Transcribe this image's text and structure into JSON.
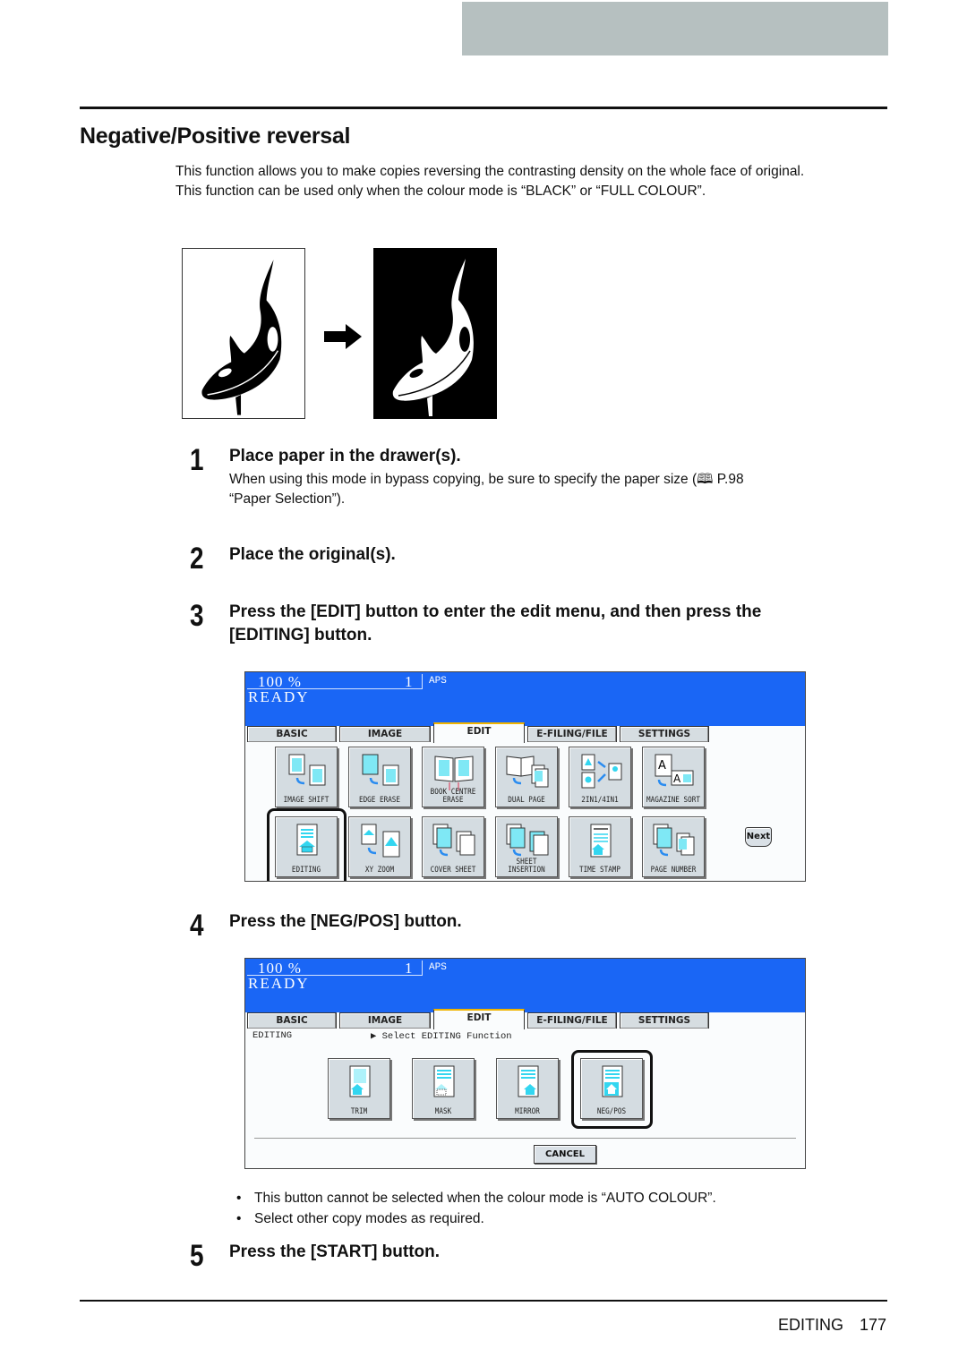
{
  "page": {
    "title": "Negative/Positive reversal",
    "intro": [
      "This function allows you to make copies reversing the contrasting density on the whole face of original.",
      "This function can be used only when the colour mode is “BLACK” or “FULL COLOUR”."
    ],
    "illustration": {
      "left_caption": "original-whale-image",
      "right_caption": "reversed-whale-image"
    },
    "steps": [
      {
        "num": "1",
        "title": "Place paper in the drawer(s).",
        "body": [
          "When using this mode in bypass copying, be sure to specify the paper size (🕮 P.98",
          "“Paper Selection”)."
        ]
      },
      {
        "num": "2",
        "title": "Place the original(s).",
        "body": []
      },
      {
        "num": "3",
        "title": "Press the [EDIT] button to enter the edit menu, and then press the",
        "title2": "[EDITING] button.",
        "body": []
      },
      {
        "num": "4",
        "title": "Press the [NEG/POS] button.",
        "body": []
      },
      {
        "num": "5",
        "title": "Press the [START] button.",
        "body": []
      }
    ],
    "bullets": [
      "This button cannot be selected when the colour mode is “AUTO COLOUR”.",
      "Select other copy modes as required."
    ],
    "footer": {
      "section": "EDITING",
      "page_number": "177"
    }
  },
  "panel": {
    "zoom": "100  %",
    "copies": "1",
    "paper": "APS",
    "status": "READY",
    "tabs": [
      "BASIC",
      "IMAGE",
      "EDIT",
      "E-FILING/FILE",
      "SETTINGS"
    ],
    "active_tab": "EDIT",
    "colors": {
      "status_bar": "#1a66f5",
      "active_tab_accent": "#f0b400",
      "icon_cyan": "#33d6f0",
      "icon_blue": "#2a8cf0"
    }
  },
  "panel1": {
    "row1": [
      "IMAGE SHIFT",
      "EDGE ERASE",
      "BOOK CENTRE\nERASE",
      "DUAL  PAGE",
      "2IN1/4IN1",
      "MAGAZINE SORT"
    ],
    "row2": [
      "EDITING",
      "XY ZOOM",
      "COVER SHEET",
      "SHEET\nINSERTION",
      "TIME STAMP",
      "PAGE NUMBER"
    ],
    "next": "Next",
    "highlighted": "EDITING"
  },
  "panel2": {
    "section": "EDITING",
    "hint": "▶ Select EDITING Function",
    "buttons": [
      "TRIM",
      "MASK",
      "MIRROR",
      "NEG/POS"
    ],
    "cancel": "CANCEL",
    "highlighted": "NEG/POS"
  }
}
